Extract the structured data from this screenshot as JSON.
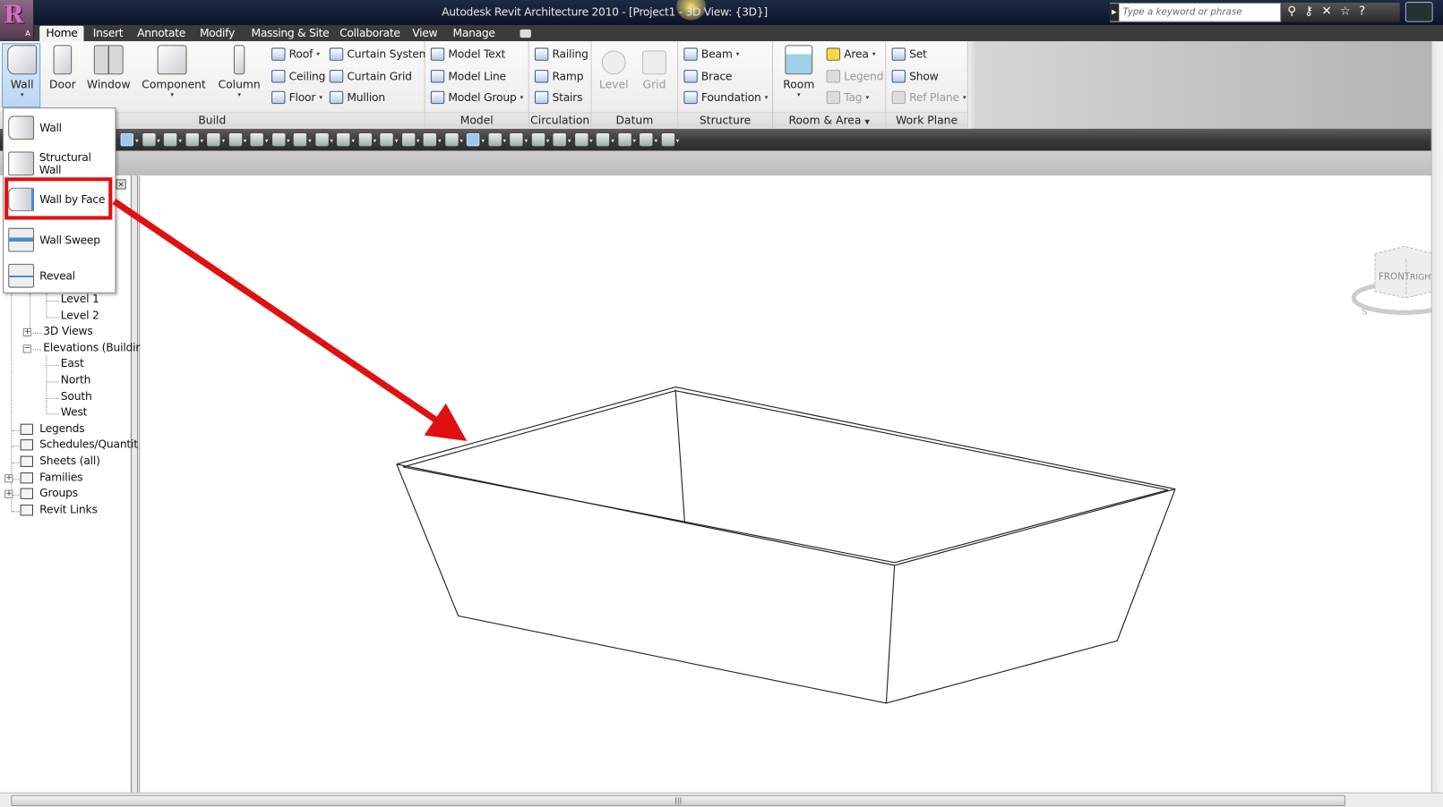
{
  "title_bar": {
    "app_letter": "R",
    "app_sub": "A",
    "title": "Autodesk Revit Architecture 2010 - [Project1 - 3D View: {3D}]",
    "search_placeholder": "Type a keyword or phrase"
  },
  "tabs": [
    "Home",
    "Insert",
    "Annotate",
    "Modify",
    "Massing & Site",
    "Collaborate",
    "View",
    "Manage"
  ],
  "ribbon": {
    "build": {
      "label": "Build",
      "wall": "Wall",
      "door": "Door",
      "window": "Window",
      "component": "Component",
      "column": "Column",
      "roof": "Roof",
      "ceiling": "Ceiling",
      "floor": "Floor",
      "curtain_system": "Curtain System",
      "curtain_grid": "Curtain Grid",
      "mullion": "Mullion"
    },
    "model": {
      "label": "Model",
      "model_text": "Model Text",
      "model_line": "Model Line",
      "model_group": "Model Group"
    },
    "circulation": {
      "label": "Circulation",
      "railing": "Railing",
      "ramp": "Ramp",
      "stairs": "Stairs"
    },
    "datum": {
      "label": "Datum",
      "level": "Level",
      "grid": "Grid"
    },
    "structure": {
      "label": "Structure",
      "beam": "Beam",
      "brace": "Brace",
      "foundation": "Foundation"
    },
    "room_area": {
      "label": "Room & Area",
      "room": "Room",
      "area": "Area",
      "legend": "Legend",
      "tag": "Tag"
    },
    "work_plane": {
      "label": "Work Plane",
      "set": "Set",
      "show": "Show",
      "ref_plane": "Ref Plane"
    }
  },
  "wall_menu": [
    "Wall",
    "Structural Wall",
    "Wall by Face",
    "Wall Sweep",
    "Reveal"
  ],
  "highlighted_item": "Wall by Face",
  "project_browser": {
    "items": [
      {
        "label": "Level 1",
        "indent": 2
      },
      {
        "label": "Level 2",
        "indent": 2
      },
      {
        "label": "3D Views",
        "indent": 1,
        "toggle": "+"
      },
      {
        "label": "Elevations (Buildir",
        "indent": 1,
        "toggle": "-"
      },
      {
        "label": "East",
        "indent": 2
      },
      {
        "label": "North",
        "indent": 2
      },
      {
        "label": "South",
        "indent": 2
      },
      {
        "label": "West",
        "indent": 2
      },
      {
        "label": "Legends",
        "indent": 0
      },
      {
        "label": "Schedules/Quantit",
        "indent": 0
      },
      {
        "label": "Sheets (all)",
        "indent": 0
      },
      {
        "label": "Families",
        "indent": 0,
        "toggle": "+"
      },
      {
        "label": "Groups",
        "indent": 0,
        "toggle": "+"
      },
      {
        "label": "Revit Links",
        "indent": 0
      }
    ]
  },
  "viewcube": {
    "front": "FRONT",
    "right": "RIGHT",
    "compass": "S"
  },
  "colors": {
    "highlight": "#e01010",
    "accent": "#6d9fd6"
  }
}
